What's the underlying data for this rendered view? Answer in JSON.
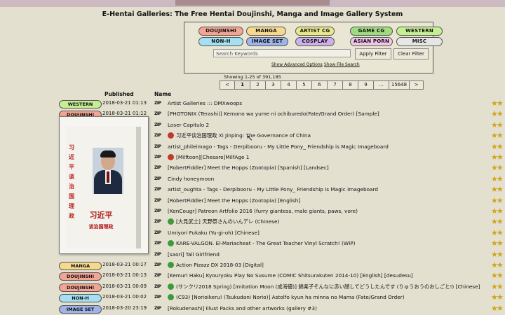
{
  "site_title": "E-Hentai Galleries: The Free Hentai Doujinshi, Manga and Image Gallery System",
  "categories": [
    {
      "label": "DOUJINSHI",
      "color": "#f4a493",
      "text_color": "#111"
    },
    {
      "label": "MANGA",
      "color": "#f6d98e",
      "text_color": "#111"
    },
    {
      "label": "ARTIST CG",
      "color": "#e9e78b",
      "text_color": "#111"
    },
    {
      "label": "GAME CG",
      "color": "#9edc7f",
      "text_color": "#111"
    },
    {
      "label": "WESTERN",
      "color": "#c6ee93",
      "text_color": "#111"
    },
    {
      "label": "NON-H",
      "color": "#a4dff2",
      "text_color": "#111"
    },
    {
      "label": "IMAGE SET",
      "color": "#9fb4ea",
      "text_color": "#111"
    },
    {
      "label": "COSPLAY",
      "color": "#cdb0ea",
      "text_color": "#111"
    },
    {
      "label": "ASIAN PORN",
      "color": "#f0c6e6",
      "text_color": "#111"
    },
    {
      "label": "MISC",
      "color": "#e6e6e6",
      "text_color": "#111"
    }
  ],
  "search": {
    "placeholder": "Search Keywords",
    "apply_label": "Apply Filter",
    "clear_label": "Clear Filter",
    "advanced_label": "Show Advanced Options",
    "file_search_label": "Show File Search"
  },
  "showing": "Showing 1-25 of 391,185",
  "pager": [
    "<",
    "1",
    "2",
    "3",
    "4",
    "5",
    "6",
    "7",
    "8",
    "9",
    "...",
    "15648",
    ">"
  ],
  "pager_current": "1",
  "table": {
    "col_published": "Published",
    "col_name": "Name",
    "icon_text": "ZIP",
    "rows": [
      {
        "category": "WESTERN",
        "cat_color": "#c6ee93",
        "date": "2018-03-21 01:13",
        "title": "Artist Galleries ::: DMXwoops",
        "mark": ""
      },
      {
        "category": "DOUJINSHI",
        "cat_color": "#f4a493",
        "date": "2018-03-21 01:12",
        "title": "[PHOTONIX (Terashi)] Kemono wa yume ni ochiburedo(Fate/Grand Order) [Sample]",
        "mark": ""
      },
      {
        "category": "",
        "cat_color": "",
        "date": "",
        "title": "Loser Capitulo 2",
        "mark": ""
      },
      {
        "category": "",
        "cat_color": "",
        "date": "",
        "title": "习近平谈治国理政 Xi Jinping: The Governance of China",
        "mark": "#c0392b"
      },
      {
        "category": "",
        "cat_color": "",
        "date": "",
        "title": "artist_phileimago - Tags - Derpibooru - My Little Pony_ Friendship is Magic Imageboard",
        "mark": ""
      },
      {
        "category": "",
        "cat_color": "",
        "date": "",
        "title": "[Milftoon][Chesare]MilfAge 1",
        "mark": "#c0392b"
      },
      {
        "category": "",
        "cat_color": "",
        "date": "",
        "title": "[RobertFiddler] Meet the Hopps (Zootopia) [Spanish] [Landsec]",
        "mark": ""
      },
      {
        "category": "",
        "cat_color": "",
        "date": "",
        "title": "Cindy honeymoon",
        "mark": ""
      },
      {
        "category": "",
        "cat_color": "",
        "date": "",
        "title": "artist_oughta - Tags - Derpibooru - My Little Pony_ Friendship is Magic Imageboard",
        "mark": ""
      },
      {
        "category": "",
        "cat_color": "",
        "date": "",
        "title": "[RobertFiddler] Meet the Hopps (Zootopia) [English]",
        "mark": ""
      },
      {
        "category": "",
        "cat_color": "",
        "date": "",
        "title": "[KenCougr] Patreon Artfolio 2016 (furry giantess, male giants, paws, vore)",
        "mark": ""
      },
      {
        "category": "",
        "cat_color": "",
        "date": "",
        "title": "[大見武士] 天野祭さんのいんデレ (Chinese)",
        "mark": "#3c9a3c"
      },
      {
        "category": "",
        "cat_color": "",
        "date": "",
        "title": "Umiyori Fukaku (Yu-gi-oh) [Chinese]",
        "mark": ""
      },
      {
        "category": "",
        "cat_color": "",
        "date": "",
        "title": "KARE-VALGON. El-Mariacheat - The Great Teacher Vinyl Scratch! (WIP)",
        "mark": "#3c9a3c"
      },
      {
        "category": "",
        "cat_color": "",
        "date": "",
        "title": "[saori] Tall Girlfriend",
        "mark": ""
      },
      {
        "category": "MANGA",
        "cat_color": "#f6d98e",
        "date": "2018-03-21 00:17",
        "title": "Action Pizazz DX 2018-03 [Digital]",
        "mark": "#3c9a3c"
      },
      {
        "category": "DOUJINSHI",
        "cat_color": "#f4a493",
        "date": "2018-03-21 00:13",
        "title": "[Kemuri Haku] Kyouryoku Play No Susume (COMIC Shitsurakuten 2014-10) [English] [desudesu]",
        "mark": ""
      },
      {
        "category": "DOUJINSHI",
        "cat_color": "#f4a493",
        "date": "2018-03-21 00:09",
        "title": "(サンクリ2018 Spring) [Imitation Moon (成海優)] 錦楽子そんなに赤い顔してどうしたんです (りゅうおうのおしごと!) [Chinese]",
        "mark": "#3c9a3c"
      },
      {
        "category": "NON-H",
        "cat_color": "#a4dff2",
        "date": "2018-03-21 00:02",
        "title": "(C93) [Norioikeru! (Tsukudani Norio)] Astolfo kyun ha minna no Mama (Fate/Grand Order)",
        "mark": "#3c9a3c"
      },
      {
        "category": "IMAGE SET",
        "cat_color": "#9fb4ea",
        "date": "2018-03-20 23:19",
        "title": "[Rokudenashi] Illust Packs and other artworks (gallery #3)",
        "mark": ""
      }
    ]
  },
  "popup": {
    "cover_vertical_text": "习近平谈治国理政",
    "cover_title": "习近平",
    "cover_subtitle": "谈治国理政"
  }
}
